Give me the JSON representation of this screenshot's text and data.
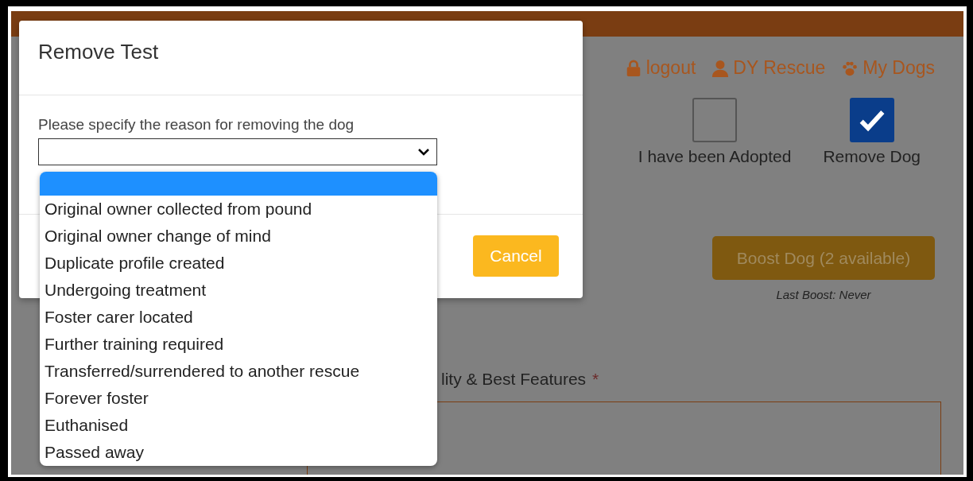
{
  "page": {
    "nav": [
      {
        "kind": "lock",
        "label": "logout"
      },
      {
        "kind": "person",
        "label": "DY Rescue"
      },
      {
        "kind": "paw",
        "label": "My Dogs"
      }
    ],
    "checkboxes": [
      {
        "label": "I have been Adopted",
        "checked": false
      },
      {
        "label": "Remove Dog",
        "checked": true
      }
    ],
    "boost_button": "Boost Dog (2 available)",
    "last_boost": "Last Boost: Never",
    "field": {
      "label": "lity & Best Features",
      "required": "*"
    }
  },
  "modal": {
    "title": "Remove Test",
    "label": "Please specify the reason for removing the dog",
    "options": [
      {
        "selected": true
      },
      {
        "label": "Original owner collected from pound",
        "selected": false
      },
      {
        "label": "Original owner change of mind",
        "selected": false
      },
      {
        "label": "Duplicate profile created",
        "selected": false
      },
      {
        "label": "Undergoing treatment",
        "selected": false
      },
      {
        "label": "Foster carer located",
        "selected": false
      },
      {
        "label": "Further training required",
        "selected": false
      },
      {
        "label": "Transferred/surrendered to another rescue",
        "selected": false
      },
      {
        "label": "Forever foster",
        "selected": false
      },
      {
        "label": "Euthanised",
        "selected": false
      },
      {
        "label": "Passed away",
        "selected": false
      }
    ],
    "buttons": [
      "Cancel"
    ]
  }
}
